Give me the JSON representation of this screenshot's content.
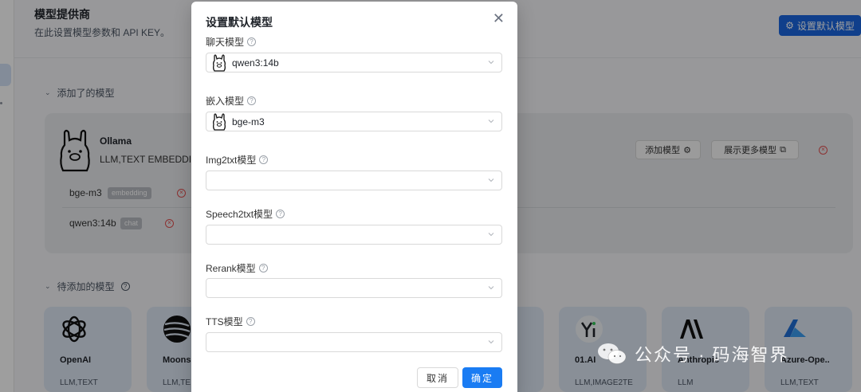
{
  "page": {
    "title": "模型提供商",
    "subtitle": "在此设置模型参数和 API KEY。",
    "set_default_button": "设置默认模型",
    "added_section": "添加了的模型",
    "pending_section": "待添加的模型"
  },
  "added_provider": {
    "name": "Ollama",
    "tags": "LLM,TEXT EMBEDDIN",
    "add_model_button": "添加模型",
    "more_models_button": "展示更多模型",
    "models": [
      {
        "name": "bge-m3",
        "tag": "embedding"
      },
      {
        "name": "qwen3:14b",
        "tag": "chat"
      }
    ]
  },
  "providers": [
    {
      "name": "OpenAI",
      "tags": "LLM,TEXT",
      "icon": "openai-logo"
    },
    {
      "name": "Moons",
      "tags": "LLM,TE",
      "icon": "moonshot-logo"
    },
    {
      "name": "01.AI",
      "tags": "LLM,IMAGE2TE",
      "icon": "yi-logo"
    },
    {
      "name": "Anthropic",
      "tags": "LLM",
      "icon": "anthropic-logo"
    },
    {
      "name": "Azure-Ope..",
      "tags": "LLM,TEXT",
      "icon": "azure-logo"
    }
  ],
  "modal": {
    "title": "设置默认模型",
    "close_icon": "close-icon",
    "fields": [
      {
        "label": "聊天模型",
        "value": "qwen3:14b",
        "icon": "ollama-llama"
      },
      {
        "label": "嵌入模型",
        "value": "bge-m3",
        "icon": "ollama-llama"
      },
      {
        "label": "Img2txt模型",
        "value": ""
      },
      {
        "label": "Speech2txt模型",
        "value": ""
      },
      {
        "label": "Rerank模型",
        "value": ""
      },
      {
        "label": "TTS模型",
        "value": ""
      }
    ],
    "cancel": "取消",
    "ok": "确定"
  },
  "watermark": {
    "label": "公众号 · 码海智界"
  },
  "colors": {
    "primary": "#1a7cf3",
    "danger": "#e24f4f",
    "card_bg": "#e9ebee",
    "provider_card_bg": "#dde7f4"
  }
}
